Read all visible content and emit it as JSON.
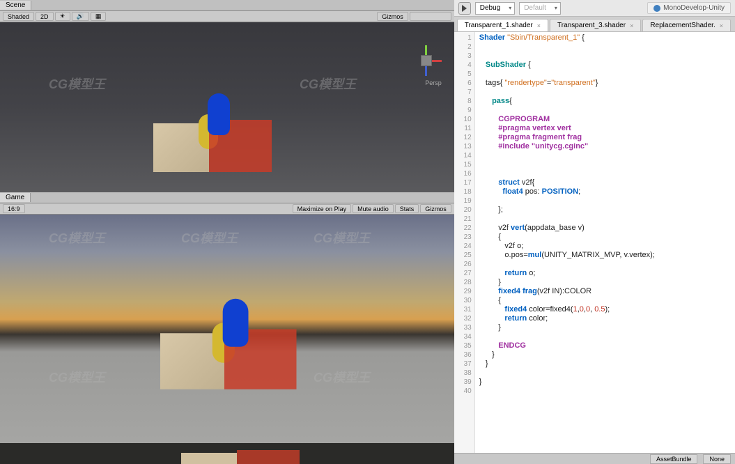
{
  "scene": {
    "tab": "Scene",
    "shading": "Shaded",
    "mode2d": "2D",
    "gizmos": "Gizmos",
    "persp": "Persp"
  },
  "game": {
    "tab": "Game",
    "aspect": "16:9",
    "maxOnPlay": "Maximize on Play",
    "muteAudio": "Mute audio",
    "stats": "Stats",
    "gizmos": "Gizmos"
  },
  "ide": {
    "debug": "Debug",
    "default": "Default",
    "appName": "MonoDevelop-Unity",
    "tabs": [
      "Transparent_1.shader",
      "Transparent_3.shader",
      "ReplacementShader."
    ],
    "activeTab": 0
  },
  "code": {
    "lines": [
      {
        "n": 1,
        "t": [
          [
            "kw-blue",
            "Shader"
          ],
          [
            "ident",
            " "
          ],
          [
            "str-orange",
            "\"Sbin/Transparent_1\""
          ],
          [
            "ident",
            " {"
          ]
        ]
      },
      {
        "n": 2,
        "t": []
      },
      {
        "n": 3,
        "t": []
      },
      {
        "n": 4,
        "t": [
          [
            "ident",
            "   "
          ],
          [
            "kw-teal",
            "SubShader"
          ],
          [
            "ident",
            " {"
          ]
        ]
      },
      {
        "n": 5,
        "t": []
      },
      {
        "n": 6,
        "t": [
          [
            "ident",
            "   tags{ "
          ],
          [
            "str-orange",
            "\"rendertype\""
          ],
          [
            "ident",
            "="
          ],
          [
            "str-orange",
            "\"transparent\""
          ],
          [
            "ident",
            "}"
          ]
        ]
      },
      {
        "n": 7,
        "t": []
      },
      {
        "n": 8,
        "t": [
          [
            "ident",
            "      "
          ],
          [
            "kw-teal",
            "pass"
          ],
          [
            "ident",
            "{"
          ]
        ]
      },
      {
        "n": 9,
        "t": []
      },
      {
        "n": 10,
        "t": [
          [
            "ident",
            "         "
          ],
          [
            "kw-purple",
            "CGPROGRAM"
          ]
        ]
      },
      {
        "n": 11,
        "t": [
          [
            "ident",
            "         "
          ],
          [
            "kw-purple",
            "#pragma vertex vert"
          ]
        ]
      },
      {
        "n": 12,
        "t": [
          [
            "ident",
            "         "
          ],
          [
            "kw-purple",
            "#pragma fragment frag"
          ]
        ]
      },
      {
        "n": 13,
        "t": [
          [
            "ident",
            "         "
          ],
          [
            "kw-purple",
            "#include \"unitycg.cginc\""
          ]
        ]
      },
      {
        "n": 14,
        "t": []
      },
      {
        "n": 15,
        "t": []
      },
      {
        "n": 16,
        "t": []
      },
      {
        "n": 17,
        "t": [
          [
            "ident",
            "         "
          ],
          [
            "kw-blue",
            "struct"
          ],
          [
            "ident",
            " v2f{"
          ]
        ]
      },
      {
        "n": 18,
        "t": [
          [
            "ident",
            "           "
          ],
          [
            "kw-blue",
            "float4"
          ],
          [
            "ident",
            " pos: "
          ],
          [
            "kw-blue",
            "POSITION"
          ],
          [
            "ident",
            ";"
          ]
        ]
      },
      {
        "n": 19,
        "t": []
      },
      {
        "n": 20,
        "t": [
          [
            "ident",
            "         };"
          ]
        ]
      },
      {
        "n": 21,
        "t": []
      },
      {
        "n": 22,
        "t": [
          [
            "ident",
            "         v2f "
          ],
          [
            "kw-blue",
            "vert"
          ],
          [
            "ident",
            "(appdata_base v)"
          ]
        ]
      },
      {
        "n": 23,
        "t": [
          [
            "ident",
            "         {"
          ]
        ]
      },
      {
        "n": 24,
        "t": [
          [
            "ident",
            "            v2f o;"
          ]
        ]
      },
      {
        "n": 25,
        "t": [
          [
            "ident",
            "            o.pos="
          ],
          [
            "kw-blue",
            "mul"
          ],
          [
            "ident",
            "(UNITY_MATRIX_MVP, v.vertex);"
          ]
        ]
      },
      {
        "n": 26,
        "t": []
      },
      {
        "n": 27,
        "t": [
          [
            "ident",
            "            "
          ],
          [
            "kw-blue",
            "return"
          ],
          [
            "ident",
            " o;"
          ]
        ]
      },
      {
        "n": 28,
        "t": [
          [
            "ident",
            "         }"
          ]
        ]
      },
      {
        "n": 29,
        "t": [
          [
            "ident",
            "         "
          ],
          [
            "kw-blue",
            "fixed4"
          ],
          [
            "ident",
            " "
          ],
          [
            "kw-blue",
            "frag"
          ],
          [
            "ident",
            "(v2f IN):COLOR"
          ]
        ]
      },
      {
        "n": 30,
        "t": [
          [
            "ident",
            "         {"
          ]
        ]
      },
      {
        "n": 31,
        "t": [
          [
            "ident",
            "            "
          ],
          [
            "kw-blue",
            "fixed4"
          ],
          [
            "ident",
            " color=fixed4("
          ],
          [
            "num-red",
            "1"
          ],
          [
            "ident",
            ","
          ],
          [
            "num-red",
            "0"
          ],
          [
            "ident",
            ","
          ],
          [
            "num-red",
            "0"
          ],
          [
            "ident",
            ", "
          ],
          [
            "num-red",
            "0.5"
          ],
          [
            "ident",
            ");"
          ]
        ]
      },
      {
        "n": 32,
        "t": [
          [
            "ident",
            "            "
          ],
          [
            "kw-blue",
            "return"
          ],
          [
            "ident",
            " color;"
          ]
        ]
      },
      {
        "n": 33,
        "t": [
          [
            "ident",
            "         }"
          ]
        ]
      },
      {
        "n": 34,
        "t": []
      },
      {
        "n": 35,
        "t": [
          [
            "ident",
            "         "
          ],
          [
            "kw-purple",
            "ENDCG"
          ]
        ]
      },
      {
        "n": 36,
        "t": [
          [
            "ident",
            "      }"
          ]
        ]
      },
      {
        "n": 37,
        "t": [
          [
            "ident",
            "   }"
          ]
        ]
      },
      {
        "n": 38,
        "t": []
      },
      {
        "n": 39,
        "t": [
          [
            "ident",
            "}"
          ]
        ]
      },
      {
        "n": 40,
        "t": []
      }
    ]
  },
  "bottomBar": {
    "assetBundle": "AssetBundle",
    "none": "None"
  },
  "watermark": "CG模型王"
}
